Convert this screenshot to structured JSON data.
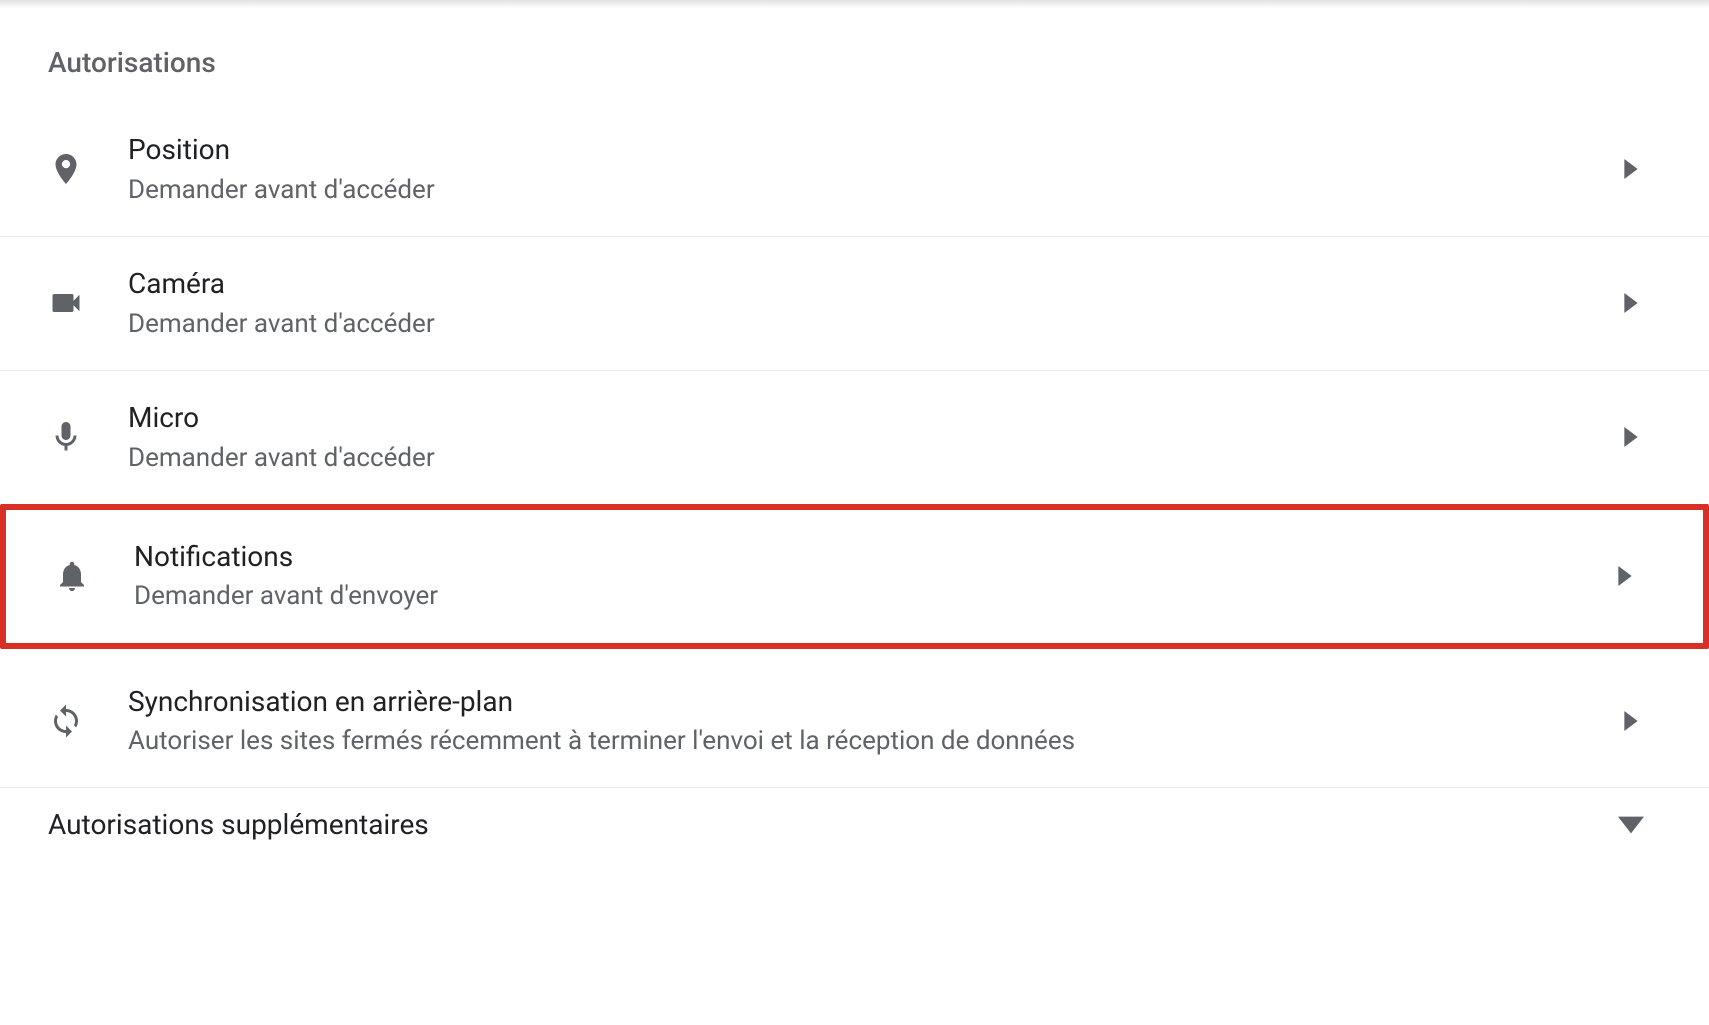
{
  "section": {
    "title": "Autorisations"
  },
  "permissions": {
    "location": {
      "title": "Position",
      "subtitle": "Demander avant d'accéder"
    },
    "camera": {
      "title": "Caméra",
      "subtitle": "Demander avant d'accéder"
    },
    "microphone": {
      "title": "Micro",
      "subtitle": "Demander avant d'accéder"
    },
    "notifications": {
      "title": "Notifications",
      "subtitle": "Demander avant d'envoyer"
    },
    "background_sync": {
      "title": "Synchronisation en arrière-plan",
      "subtitle": "Autoriser les sites fermés récemment à terminer l'envoi et la réception de données"
    }
  },
  "expand": {
    "label": "Autorisations supplémentaires"
  },
  "highlight": {
    "target": "notifications",
    "color": "#d93025"
  }
}
